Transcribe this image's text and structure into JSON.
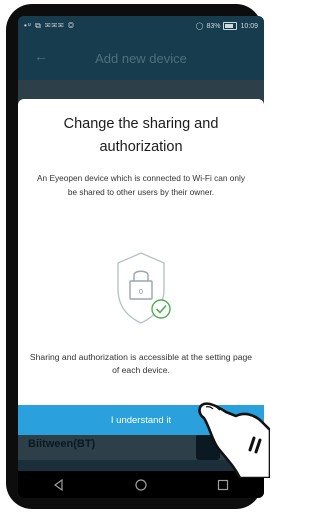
{
  "status_bar": {
    "left_icons": "•ᵘ ⧉ ✉✉✉ ◎",
    "right_text": "83%",
    "time": "10:09",
    "battery_level": 0.83
  },
  "app_bar": {
    "back_icon": "arrow-left-icon",
    "title": "Add new device"
  },
  "background_screen": {
    "device_label": "Biitween(BT)"
  },
  "dialog": {
    "title": "Change the sharing and authorization",
    "body": "An Eyeopen device which is connected to Wi-Fi can only be shared to other users by their owner.",
    "illustration_icon": "shield-lock-check-icon",
    "lock_digit": "0",
    "footer": "Sharing and authorization is accessible at the setting page of each device.",
    "confirm_label": "I understand it"
  },
  "nav_bar": {
    "back_icon": "triangle-back-icon",
    "home_icon": "circle-home-icon",
    "recents_icon": "square-recents-icon"
  },
  "colors": {
    "accent": "#2aa0dd",
    "check_green": "#4caf50",
    "app_bar": "#173c4d"
  }
}
